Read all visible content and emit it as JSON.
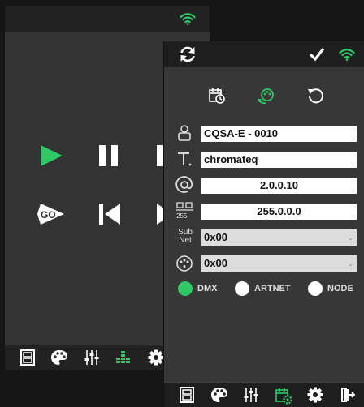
{
  "colors": {
    "accent": "#2ec866",
    "panel_bg": "#373737",
    "back_bg": "#333333",
    "bar_bg": "#1e1e1e",
    "field_bg": "#ffffff",
    "select_bg": "#dcdcdc"
  },
  "back_window": {
    "status_icon": "wifi-icon",
    "controls": [
      "play-icon",
      "pause-icon",
      "stop-icon",
      "go-icon",
      "skip-back-icon",
      "skip-forward-icon"
    ],
    "go_label": "GO",
    "bottom_tabs": [
      "film-icon",
      "palette-icon",
      "sliders-icon",
      "levels-icon",
      "gear-icon"
    ]
  },
  "panel": {
    "top_icons": [
      "refresh-icon",
      "check-icon",
      "wifi-icon"
    ],
    "quick_icons": [
      "calendar-clock-icon",
      "palette-sync-icon",
      "reset-icon"
    ],
    "name": {
      "icon": "user-icon",
      "value": "CQSA-E - 0010"
    },
    "label": {
      "icon": "text-icon",
      "value": "chromateq"
    },
    "ip": {
      "icon": "at-icon",
      "value": "2.0.0.10"
    },
    "mask": {
      "icon": "netmask-icon",
      "icon_label": "255.",
      "value": "255.0.0.0"
    },
    "subnet": {
      "label_line1": "Sub",
      "label_line2": "Net",
      "value": "0x00"
    },
    "universe": {
      "icon": "dmx-connector-icon",
      "value": "0x00"
    },
    "protocols": [
      {
        "label": "DMX",
        "selected": true
      },
      {
        "label": "ARTNET",
        "selected": false
      },
      {
        "label": "NODE",
        "selected": false
      }
    ],
    "bottom_tabs": [
      "film-icon",
      "palette-icon",
      "sliders-icon",
      "calendar-gear-icon",
      "gear-icon",
      "exit-icon"
    ]
  }
}
